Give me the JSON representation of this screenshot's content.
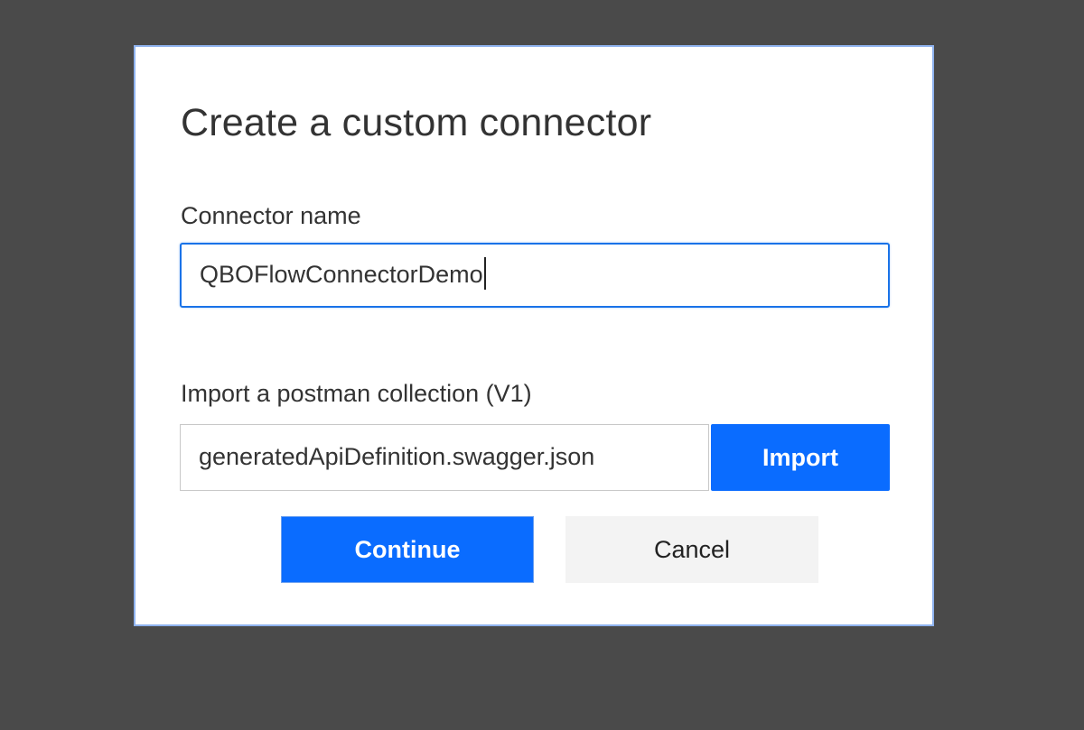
{
  "dialog": {
    "title": "Create a custom connector",
    "connector_name_label": "Connector name",
    "connector_name_value": "QBOFlowConnectorDemo",
    "import_label": "Import a postman collection (V1)",
    "import_file_value": "generatedApiDefinition.swagger.json",
    "import_button_label": "Import",
    "continue_button_label": "Continue",
    "cancel_button_label": "Cancel"
  },
  "colors": {
    "backdrop": "#4a4a4a",
    "dialog_border": "#8fb3ef",
    "primary": "#0a6cff",
    "focus_border": "#1a73e8",
    "secondary_button": "#f3f3f3"
  }
}
